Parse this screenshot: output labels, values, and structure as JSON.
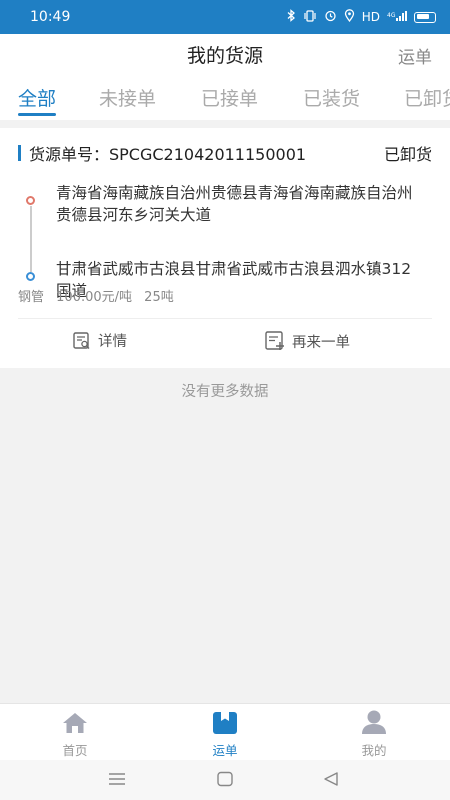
{
  "status_bar": {
    "time": "10:49",
    "network": "HD",
    "signal": "4G"
  },
  "header": {
    "title": "我的货源",
    "action_label": "运单"
  },
  "tabs": [
    {
      "label": "全部",
      "active": true
    },
    {
      "label": "未接单",
      "active": false
    },
    {
      "label": "已接单",
      "active": false
    },
    {
      "label": "已装货",
      "active": false
    },
    {
      "label": "已卸货",
      "active": false
    }
  ],
  "order": {
    "number_label": "货源单号：SPCGC21042011150001",
    "status": "已卸货",
    "from_address": "青海省海南藏族自治州贵德县青海省海南藏族自治州贵德县河东乡河关大道",
    "to_address": "甘肃省武威市古浪县甘肃省武威市古浪县泗水镇312国道",
    "cargo": "钢管",
    "price": "100.00元/吨",
    "weight": "25吨",
    "detail_label": "详情",
    "reorder_label": "再来一单"
  },
  "list_footer": "没有更多数据",
  "bottom_nav": {
    "home": "首页",
    "waybill": "运单",
    "mine": "我的",
    "active": "waybill"
  },
  "colors": {
    "accent": "#1f7fc4",
    "status_bar": "#1f7fc4",
    "origin_dot": "#e0786a",
    "destination_dot": "#3a8fd6"
  }
}
